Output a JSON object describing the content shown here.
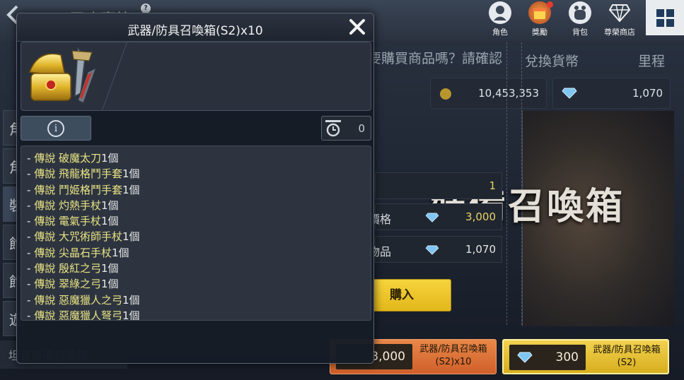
{
  "background": {
    "title": "召喚寶箱",
    "top_menu": [
      {
        "label": "角色",
        "icon": "character-icon"
      },
      {
        "label": "獎勵",
        "icon": "reward-icon"
      },
      {
        "label": "背包",
        "icon": "backpack-icon"
      },
      {
        "label": "尊榮商店",
        "icon": "diamond-shop-icon"
      }
    ],
    "headers": {
      "question": "要購買商品嗎？請確認",
      "exchange_currency": "兌換貨幣",
      "mileage": "里程"
    },
    "currency": {
      "gold": "10,453,353",
      "diamond": "1,070"
    },
    "banner_title": "裝備召喚箱",
    "detail": {
      "quantity": "1",
      "price_label": "價格",
      "price_value": "3,000",
      "owned_label": "物品",
      "owned_value": "1,070"
    },
    "buy_label": "購入",
    "products": [
      {
        "price": "3,000",
        "name": "武器/防具召喚箱(S2)x10"
      },
      {
        "price": "300",
        "name": "武器/防具召喚箱(S2)"
      }
    ],
    "side_tabs": [
      "角",
      "角",
      "裝",
      "飾",
      "飾",
      "遊"
    ],
    "bottom_text": "坦克裝備召喚箱"
  },
  "dialog": {
    "title": "武器/防具召喚箱(S2)x10",
    "ghost_text": "武器/防具召喚箱(S2)x10",
    "timer_value": "0",
    "items": [
      {
        "tier": "傳說",
        "name": "破魔太刀",
        "qty": "1個"
      },
      {
        "tier": "傳說",
        "name": "飛龍格鬥手套",
        "qty": "1個"
      },
      {
        "tier": "傳說",
        "name": "鬥姬格鬥手套",
        "qty": "1個"
      },
      {
        "tier": "傳說",
        "name": "灼熱手杖",
        "qty": "1個"
      },
      {
        "tier": "傳說",
        "name": "電氣手杖",
        "qty": "1個"
      },
      {
        "tier": "傳說",
        "name": "大咒術師手杖",
        "qty": "1個"
      },
      {
        "tier": "傳說",
        "name": "尖晶石手杖",
        "qty": "1個"
      },
      {
        "tier": "傳說",
        "name": "殷紅之弓",
        "qty": "1個"
      },
      {
        "tier": "傳說",
        "name": "翠綠之弓",
        "qty": "1個"
      },
      {
        "tier": "傳說",
        "name": "惡魔獵人之弓",
        "qty": "1個"
      },
      {
        "tier": "傳說",
        "name": "惡魔獵人弩弓",
        "qty": "1個"
      }
    ]
  },
  "colors": {
    "legendary_text": "#e9e483",
    "buy_button": "#f5d43b",
    "orange_tab": "#e0733a",
    "yellow_tab": "#e8c53a"
  }
}
